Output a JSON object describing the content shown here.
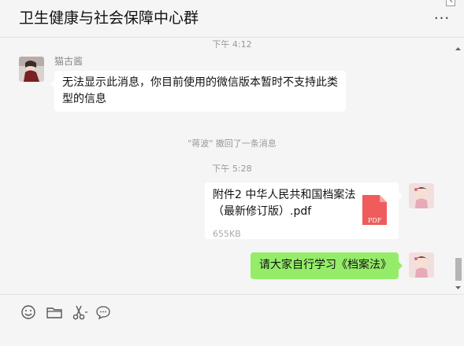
{
  "header": {
    "title": "卫生健康与社会保障中心群",
    "more_label": "···"
  },
  "messages": {
    "time_top": "下午 4:12",
    "msg1": {
      "sender": "猫古酱",
      "text_line1": "无法显示此消息，你目前使用的微信版本暂时不支持此类",
      "text_line2": "型的信息"
    },
    "recall_notice": "\"蒋波\" 撤回了一条消息",
    "time_second": "下午 5:28",
    "file_msg": {
      "name_line1": "附件2  中华人民共和国档案法",
      "name_line2": "（最新修订版）.pdf",
      "size": "655KB",
      "icon_label": "PDF"
    },
    "msg3": {
      "text": "请大家自行学习《档案法》"
    }
  },
  "toolbar": {
    "icons": [
      "emoji-icon",
      "folder-icon",
      "scissors-icon",
      "chat-bubble-icon"
    ]
  },
  "colors": {
    "background": "#f5f5f5",
    "bubble_self": "#95ec69",
    "bubble_other": "#ffffff",
    "pdf_red": "#f05b5b"
  }
}
